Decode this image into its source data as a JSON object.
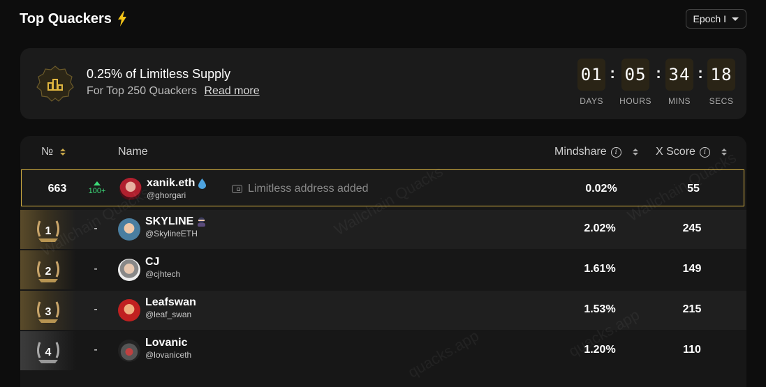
{
  "header": {
    "title": "Top Quackers",
    "epoch_label": "Epoch I"
  },
  "banner": {
    "title": "0.25% of Limitless Supply",
    "subtitle": "For Top 250 Quackers",
    "read_more": "Read more",
    "countdown": [
      {
        "value": "01",
        "label": "DAYS"
      },
      {
        "value": "05",
        "label": "HOURS"
      },
      {
        "value": "34",
        "label": "MINS"
      },
      {
        "value": "18",
        "label": "SECS"
      }
    ]
  },
  "table": {
    "headers": {
      "rank": "№",
      "name": "Name",
      "mindshare": "Mindshare",
      "xscore": "X Score"
    },
    "me": {
      "rank": "663",
      "change": "100+",
      "name": "xanik.eth",
      "handle": "@ghorgari",
      "status": "Limitless address added",
      "mindshare": "0.02%",
      "xscore": "55"
    },
    "rows": [
      {
        "rank": "1",
        "change": "-",
        "name": "SKYLINE",
        "handle": "@SkylineETH",
        "mindshare": "2.02%",
        "xscore": "245"
      },
      {
        "rank": "2",
        "change": "-",
        "name": "CJ",
        "handle": "@cjhtech",
        "mindshare": "1.61%",
        "xscore": "149"
      },
      {
        "rank": "3",
        "change": "-",
        "name": "Leafswan",
        "handle": "@leaf_swan",
        "mindshare": "1.53%",
        "xscore": "215"
      },
      {
        "rank": "4",
        "change": "-",
        "name": "Lovanic",
        "handle": "@lovaniceth",
        "mindshare": "1.20%",
        "xscore": "110"
      }
    ]
  },
  "watermark": {
    "text": "Wallchain Quacks",
    "text2": "quacks.app"
  },
  "colors": {
    "accent": "#d9b443",
    "up": "#3ddc7a",
    "bg": "#0d0d0d"
  }
}
